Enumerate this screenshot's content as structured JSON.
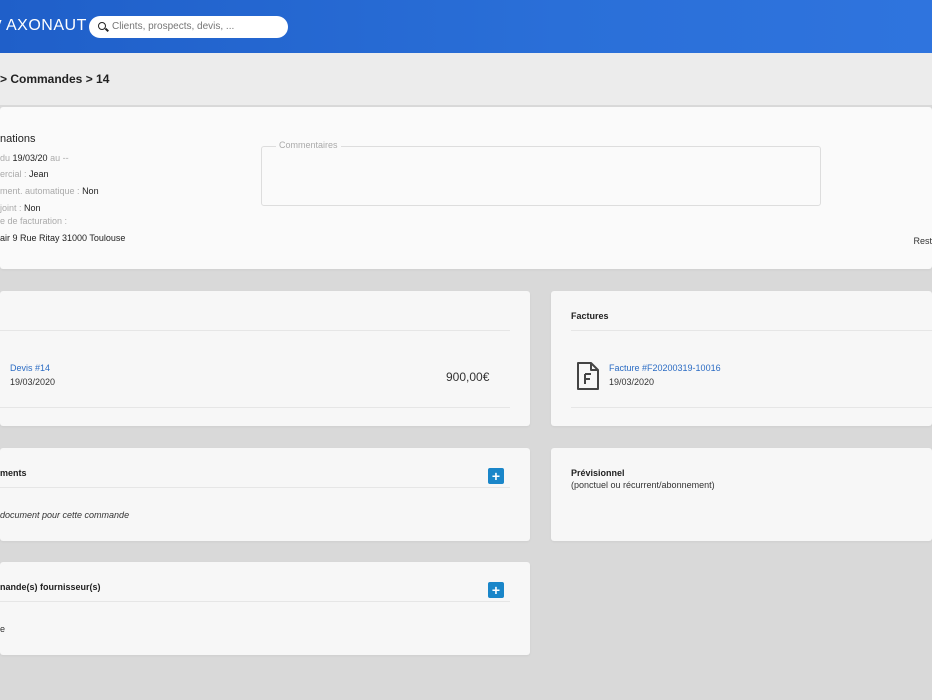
{
  "header": {
    "app_name": "AXONAUT",
    "search_placeholder": "Clients, prospects, devis, ...",
    "brand_color": "#2a6fd8"
  },
  "breadcrumb": "> Commandes > 14",
  "informations": {
    "title": "nations",
    "lines": [
      {
        "label": "du",
        "value": "19/03/20",
        "suffix": "au --"
      },
      {
        "label": "ercial :",
        "value": "Jean"
      },
      {
        "label": "ment. automatique :",
        "value": "Non"
      },
      {
        "label": "joint :",
        "value": "Non"
      },
      {
        "label": "e de facturation :",
        "value": ""
      },
      {
        "label": "",
        "value": "air 9 Rue Ritay 31000 Toulouse"
      }
    ],
    "comments_label": "Commentaires",
    "right_text": "Rest"
  },
  "devis": {
    "link": "Devis #14",
    "date": "19/03/2020",
    "amount": "900,00€"
  },
  "factures": {
    "title": "Factures",
    "link": "Facture #F20200319-10016",
    "date": "19/03/2020",
    "icon": "invoice-file-icon"
  },
  "documents": {
    "title": "ments",
    "empty_text": "document pour cette commande",
    "add_icon": "plus-icon"
  },
  "previsionnel": {
    "title": "Prévisionnel",
    "subtitle": "(ponctuel ou récurrent/abonnement)"
  },
  "commandes_fournisseurs": {
    "title": "nande(s) fournisseur(s)",
    "empty_text": "e",
    "add_icon": "plus-icon"
  }
}
